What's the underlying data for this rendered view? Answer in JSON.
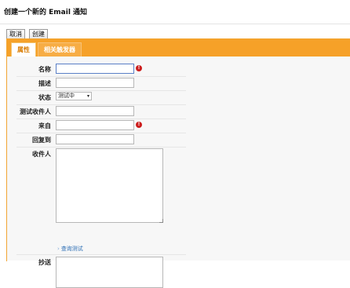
{
  "page_title": "创建一个新的 Email 通知",
  "toolbar": {
    "cancel_label": "取消",
    "create_label": "创建"
  },
  "tabs": [
    {
      "label": "属性",
      "active": true
    },
    {
      "label": "相关触发器",
      "active": false
    }
  ],
  "form": {
    "name_label": "名称",
    "name_value": "",
    "description_label": "描述",
    "description_value": "",
    "status_label": "状态",
    "status_value": "测试中",
    "test_recipient_label": "测试收件人",
    "test_recipient_value": "",
    "from_label": "来自",
    "from_value": "",
    "reply_to_label": "回复到",
    "reply_to_value": "",
    "recipients_label": "收件人",
    "recipients_value": "",
    "query_test_link": "查询测试",
    "cc_label": "抄送",
    "cc_value": ""
  },
  "icons": {
    "required": "exclamation-icon",
    "dropdown": "chevron-down-icon"
  },
  "colors": {
    "accent": "#f6a128",
    "required": "#cc1d1d",
    "link": "#2e6fb5"
  }
}
